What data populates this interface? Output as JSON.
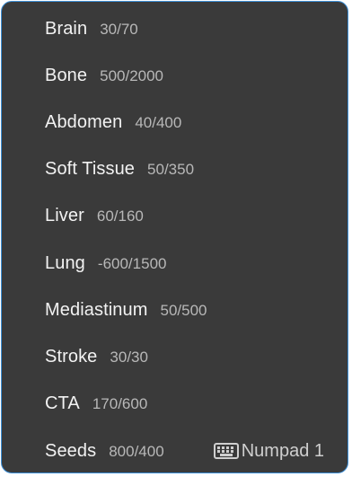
{
  "presets": [
    {
      "label": "Brain",
      "value": "30/70"
    },
    {
      "label": "Bone",
      "value": "500/2000"
    },
    {
      "label": "Abdomen",
      "value": "40/400"
    },
    {
      "label": "Soft Tissue",
      "value": "50/350"
    },
    {
      "label": "Liver",
      "value": "60/160"
    },
    {
      "label": "Lung",
      "value": "-600/1500"
    },
    {
      "label": "Mediastinum",
      "value": "50/500"
    },
    {
      "label": "Stroke",
      "value": "30/30"
    },
    {
      "label": "CTA",
      "value": "170/600"
    },
    {
      "label": "Seeds",
      "value": "800/400",
      "shortcut": "Numpad 1",
      "shortcut_icon": "keyboard-icon"
    }
  ],
  "colors": {
    "background": "#3a3a3a",
    "border": "#3d8fd6",
    "label": "#f2f2f2",
    "value": "#b8b8b8"
  }
}
